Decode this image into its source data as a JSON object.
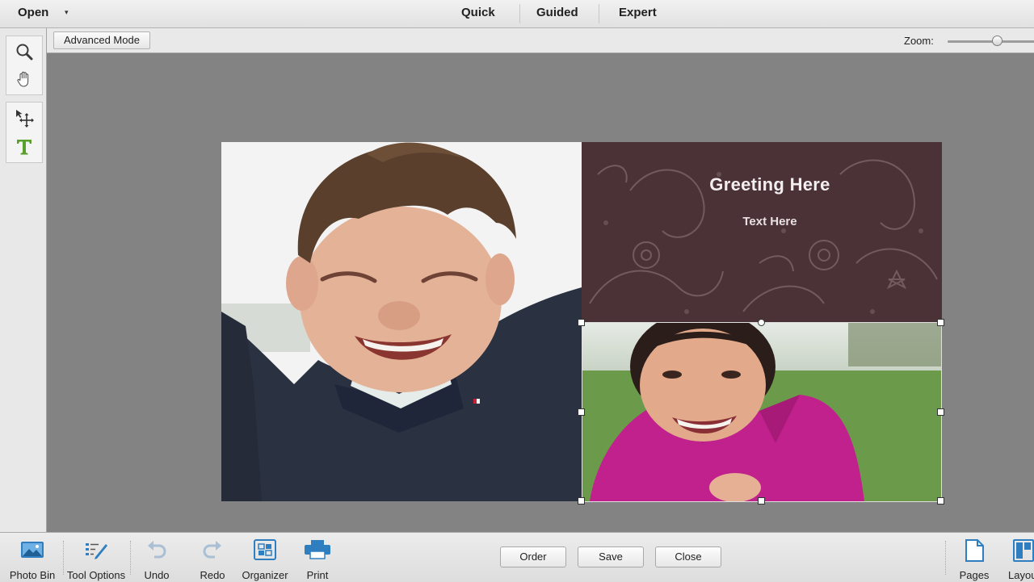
{
  "topbar": {
    "open_label": "Open",
    "open_arrow": "▾",
    "tabs": [
      {
        "label": "Quick"
      },
      {
        "label": "Guided"
      },
      {
        "label": "Expert"
      }
    ]
  },
  "options_bar": {
    "advanced_mode_label": "Advanced Mode",
    "zoom_label": "Zoom:",
    "zoom_level": 0.55
  },
  "toolbox": {
    "tools": [
      {
        "name": "zoom-tool",
        "icon": "magnifier-icon"
      },
      {
        "name": "hand-tool",
        "icon": "hand-icon"
      },
      {
        "name": "move-tool",
        "icon": "move-arrows-icon"
      },
      {
        "name": "type-tool",
        "icon": "type-T-icon"
      }
    ]
  },
  "canvas": {
    "greeting_title": "Greeting Here",
    "greeting_subtitle": "Text Here",
    "panel_color": "#4a3237"
  },
  "bottombar": {
    "left_items": [
      {
        "label": "Photo Bin",
        "icon": "photo-bin-icon"
      },
      {
        "label": "Tool Options",
        "icon": "tool-options-icon"
      },
      {
        "label": "Undo",
        "icon": "undo-icon"
      },
      {
        "label": "Redo",
        "icon": "redo-icon"
      },
      {
        "label": "Organizer",
        "icon": "organizer-icon"
      },
      {
        "label": "Print",
        "icon": "print-icon"
      }
    ],
    "center_buttons": [
      {
        "label": "Order"
      },
      {
        "label": "Save"
      },
      {
        "label": "Close"
      }
    ],
    "right_items": [
      {
        "label": "Pages",
        "icon": "pages-icon"
      },
      {
        "label": "Layou",
        "icon": "layouts-icon"
      }
    ]
  },
  "colors": {
    "workspace_bg": "#838383",
    "accent_blue": "#2f7fc0"
  }
}
